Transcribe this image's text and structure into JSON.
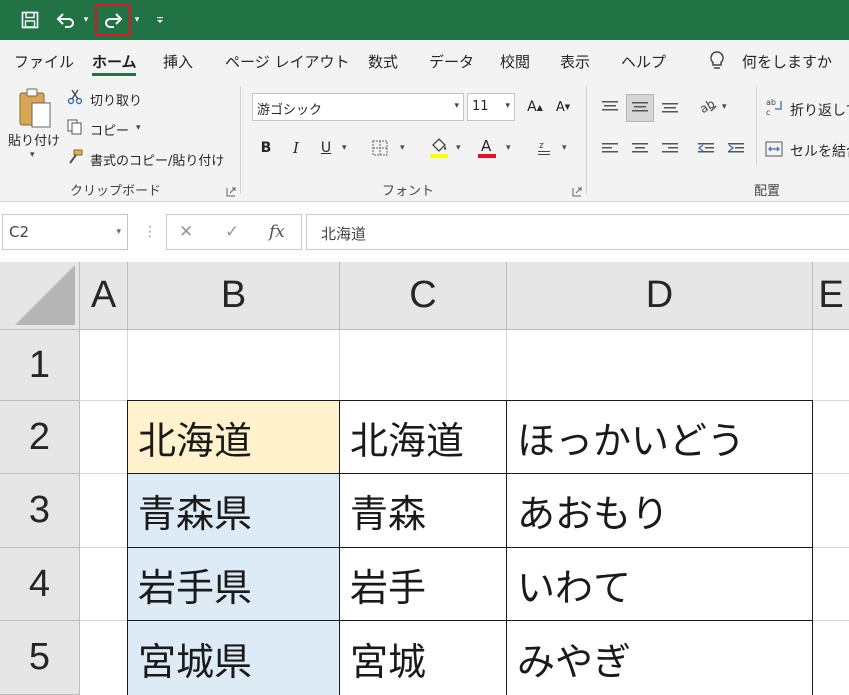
{
  "qat": {
    "save_icon": "save-icon",
    "undo_icon": "undo-icon",
    "redo_icon": "redo-icon",
    "customize_icon": "customize-qat-icon"
  },
  "tabs": [
    {
      "label": "ファイル"
    },
    {
      "label": "ホーム"
    },
    {
      "label": "挿入"
    },
    {
      "label": "ページ レイアウト"
    },
    {
      "label": "数式"
    },
    {
      "label": "データ"
    },
    {
      "label": "校閲"
    },
    {
      "label": "表示"
    },
    {
      "label": "ヘルプ"
    }
  ],
  "tell_me": "何をしますか",
  "clipboard": {
    "paste_label": "貼り付け",
    "cut_label": "切り取り",
    "copy_label": "コピー",
    "format_painter_label": "書式のコピー/貼り付け",
    "group_label": "クリップボード"
  },
  "font": {
    "font_name": "游ゴシック",
    "font_size": "11",
    "bold": "B",
    "italic": "I",
    "underline": "U",
    "group_label": "フォント",
    "fill_color": "#ffff00",
    "font_color": "#e81123"
  },
  "alignment": {
    "wrap_text_label": "折り返して",
    "merge_label": "セルを結合",
    "group_label": "配置"
  },
  "formula_bar": {
    "name_box": "C2",
    "fx": "fx",
    "value": "北海道"
  },
  "sheet": {
    "columns": [
      "A",
      "B",
      "C",
      "D",
      "E"
    ],
    "rows": [
      "1",
      "2",
      "3",
      "4",
      "5"
    ],
    "cells": {
      "B2": "北海道",
      "C2": "北海道",
      "D2": "ほっかいどう",
      "B3": "青森県",
      "C3": "青森",
      "D3": "あおもり",
      "B4": "岩手県",
      "C4": "岩手",
      "D4": "いわて",
      "B5": "宮城県",
      "C5": "宮城",
      "D5": "みやぎ"
    },
    "b2_fill": "#fff2cc",
    "b_col_fill": "#ddebf7"
  }
}
